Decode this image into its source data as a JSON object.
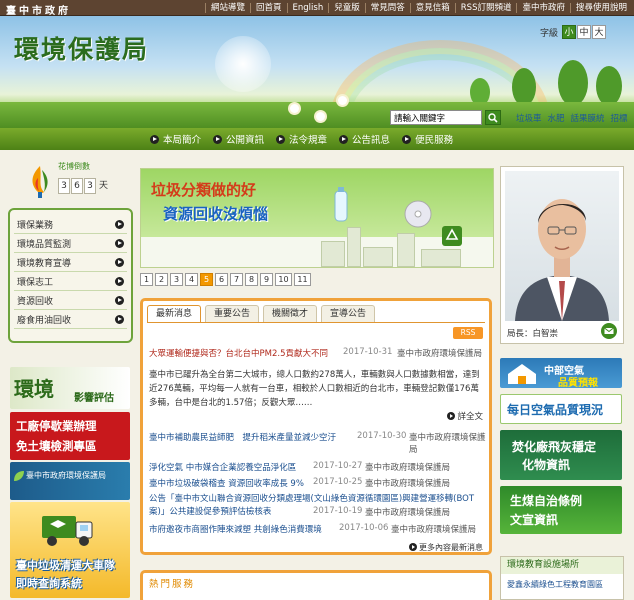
{
  "top_bar": {
    "gov_name": "臺中市政府",
    "links": [
      "網站導覽",
      "回首頁",
      "English",
      "兒童版",
      "常見問答",
      "意見信箱",
      "RSS訂閱頻道",
      "臺中市政府",
      "搜尋使用說明"
    ]
  },
  "header": {
    "site_title": "環境保護局",
    "font_size_label": "字級",
    "font_sizes": [
      "小",
      "中",
      "大"
    ],
    "search_placeholder": "請輸入關鍵字",
    "search_links": [
      "垃圾車",
      "水肥",
      "話果膜統",
      "招標"
    ]
  },
  "nav": {
    "items": [
      "本局簡介",
      "公開資訊",
      "法令規章",
      "公告訊息",
      "便民服務"
    ]
  },
  "visitor": {
    "label": "花博倒數",
    "digits": [
      "3",
      "6",
      "3"
    ],
    "unit": "天"
  },
  "sidebar": {
    "items": [
      "環保業務",
      "環境品質監測",
      "環境教育宣導",
      "環保志工",
      "資源回收",
      "廢食用油回收"
    ]
  },
  "left_banners": {
    "eia_1": "環境",
    "eia_2": "影響評估",
    "factory_1": "工廠停歇業辦理",
    "factory_2": "免土壤檢測專區",
    "epb": "臺中市政府環境保護局",
    "truck_1": "臺中垃圾清運大車隊",
    "truck_2": "即時查詢系統"
  },
  "slide": {
    "line1": "垃圾分類做的好",
    "line2": "資源回收沒煩惱",
    "pages": [
      "1",
      "2",
      "3",
      "4",
      "5",
      "6",
      "7",
      "8",
      "9",
      "10",
      "11"
    ],
    "active_page": "5"
  },
  "news": {
    "tabs": [
      "最新消息",
      "重要公告",
      "機關徵才",
      "宣導公告"
    ],
    "rss": "RSS",
    "featured": {
      "title": "大眾運輸便捷與否？台北台中PM2.5貢獻大不同",
      "date": "2017-10-31",
      "source": "臺中市政府環境保護局",
      "body": "臺中市已躍升為全台第二大城市，總人口數約278萬人，車輛數與人口數據數相當，達到近276萬輛，平均每一人就有一台車，相較於人口數相近的台北市，車輛登記數僅176萬多輛，台中是台北的1.57倍；反觀大眾……",
      "more": "詳全文"
    },
    "rows": [
      {
        "title": "臺中市補助農民益師肥　提升稻米產量並減少空汙",
        "date": "2017-10-30",
        "source": "臺中市政府環境保護局"
      },
      {
        "title": "淨化空氣 中市媒合企業認養空品淨化區",
        "date": "2017-10-27",
        "source": "臺中市政府環境保護局"
      },
      {
        "title": "臺中市垃圾破袋稽查 資源回收率成長 9%",
        "date": "2017-10-25",
        "source": "臺中市政府環境保護局"
      },
      {
        "title": "公告「臺中市文山聯合資源回收分類處理場(文山綠色資源循環園區)興建營運移轉(BOT案)」公共建設促參預評估檢核表",
        "date": "2017-10-19",
        "source": "臺中市政府環境保護局"
      },
      {
        "title": "市府邀夜市商圈作陣來減塑 共創綠色消費環境",
        "date": "2017-10-06",
        "source": "臺中市政府環境保護局"
      }
    ],
    "more_link": "更多內容最新消息"
  },
  "hot": {
    "title": "熱門服務"
  },
  "director": {
    "caption": "局長：白智崇"
  },
  "right_banners": {
    "aq_1": "中部空氣",
    "aq_2": "品質預報",
    "daily": "每日空氣品質現況",
    "incin_1": "焚化廠飛灰穩定",
    "incin_2": "化物資訊",
    "coal_1": "生煤自治條例",
    "coal_2": "文宣資訊"
  },
  "edu": {
    "title": "環境教育設施場所",
    "item": "愛鑫永續綠色工程教育園區"
  },
  "colors": {
    "top_bar": "#5d4431",
    "nav": "#5d9322",
    "accent_orange": "#f0a23a",
    "news_red": "#b0291c"
  }
}
